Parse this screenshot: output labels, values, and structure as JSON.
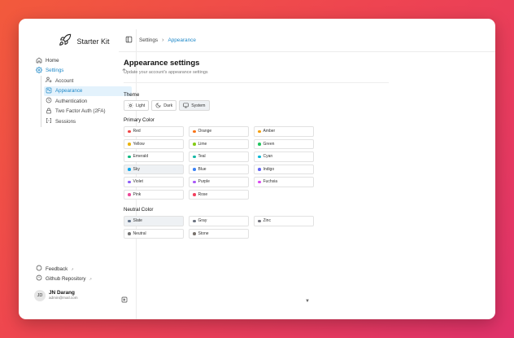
{
  "brand": {
    "name": "Starter Kit"
  },
  "nav": {
    "home": "Home",
    "settings": "Settings",
    "sub": [
      {
        "label": "Account",
        "icon": "user-cog-icon"
      },
      {
        "label": "Appearance",
        "icon": "palette-icon"
      },
      {
        "label": "Authentication",
        "icon": "clock-icon"
      },
      {
        "label": "Two Factor Auth (2FA)",
        "icon": "lock-icon"
      },
      {
        "label": "Sessions",
        "icon": "sessions-icon"
      }
    ],
    "feedback": "Feedback",
    "github": "Github Repository"
  },
  "user": {
    "initials": "JD",
    "name": "JN Darang",
    "email": "admin@mail.com"
  },
  "breadcrumb": {
    "parent": "Settings",
    "current": "Appearance"
  },
  "page": {
    "title": "Appearance settings",
    "subtitle": "Update your account's appearance settings"
  },
  "theme": {
    "label": "Theme",
    "options": [
      {
        "label": "Light",
        "icon": "sun-icon"
      },
      {
        "label": "Dark",
        "icon": "moon-icon"
      },
      {
        "label": "System",
        "icon": "monitor-icon"
      }
    ],
    "selected": "System"
  },
  "primary": {
    "label": "Primary Color",
    "selected": "Sky",
    "colors": [
      {
        "name": "Red",
        "color": "#ef4444"
      },
      {
        "name": "Orange",
        "color": "#f97316"
      },
      {
        "name": "Amber",
        "color": "#f59e0b"
      },
      {
        "name": "Yellow",
        "color": "#eab308"
      },
      {
        "name": "Lime",
        "color": "#84cc16"
      },
      {
        "name": "Green",
        "color": "#22c55e"
      },
      {
        "name": "Emerald",
        "color": "#10b981"
      },
      {
        "name": "Teal",
        "color": "#14b8a6"
      },
      {
        "name": "Cyan",
        "color": "#06b6d4"
      },
      {
        "name": "Sky",
        "color": "#0ea5e9"
      },
      {
        "name": "Blue",
        "color": "#3b82f6"
      },
      {
        "name": "Indigo",
        "color": "#6366f1"
      },
      {
        "name": "Violet",
        "color": "#8b5cf6"
      },
      {
        "name": "Purple",
        "color": "#a855f7"
      },
      {
        "name": "Fuchsia",
        "color": "#d946ef"
      },
      {
        "name": "Pink",
        "color": "#ec4899"
      },
      {
        "name": "Rose",
        "color": "#f43f5e"
      }
    ]
  },
  "neutral": {
    "label": "Neutral Color",
    "selected": "Slate",
    "colors": [
      {
        "name": "Slate",
        "color": "#64748b"
      },
      {
        "name": "Gray",
        "color": "#6b7280"
      },
      {
        "name": "Zinc",
        "color": "#71717a"
      },
      {
        "name": "Neutral",
        "color": "#737373"
      },
      {
        "name": "Stone",
        "color": "#78716c"
      }
    ]
  },
  "accent": "#1e88c8"
}
